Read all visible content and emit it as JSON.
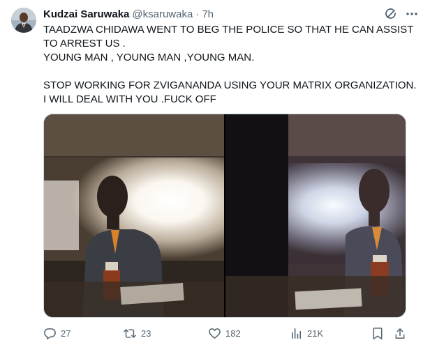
{
  "author": {
    "name": "Kudzai Saruwaka",
    "handle": "@ksaruwaka",
    "time": "7h"
  },
  "tweet": {
    "text": "TAADZWA CHIDAWA WENT TO BEG THE POLICE SO THAT HE CAN ASSIST TO ARREST US .\nYOUNG MAN , YOUNG MAN ,YOUNG MAN.\n\nSTOP WORKING FOR ZVIGANANDA USING YOUR MATRIX ORGANIZATION. I WILL DEAL WITH YOU .FUCK OFF"
  },
  "icons": {
    "header": [
      "grok-icon",
      "more-icon"
    ],
    "actions": [
      "reply-icon",
      "retweet-icon",
      "like-icon",
      "views-icon",
      "bookmark-icon",
      "share-icon"
    ]
  },
  "stats": {
    "replies": "27",
    "retweets": "23",
    "likes": "182",
    "views": "21K"
  },
  "colors": {
    "text": "#0f1419",
    "secondary": "#536471",
    "border": "#cfd9de"
  }
}
